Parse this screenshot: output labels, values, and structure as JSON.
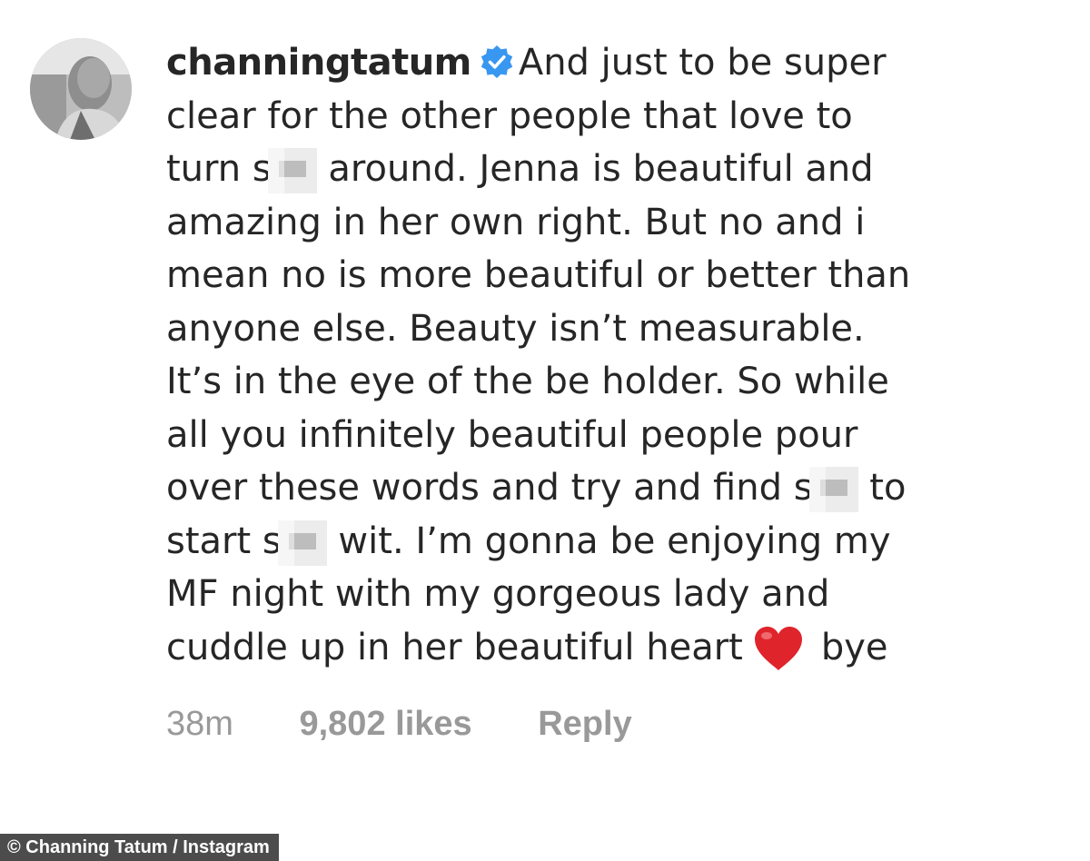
{
  "comment": {
    "username": "channingtatum",
    "verified": true,
    "icons": {
      "avatar": "profile-photo",
      "verified": "verified-badge-icon",
      "heart": "red-heart-emoji",
      "censor": "pixelated-censor-block"
    },
    "colors": {
      "verified_badge": "#3897f0",
      "heart": "#e0242c",
      "meta_text": "#999999"
    },
    "lines": [
      {
        "text": "And just to be super"
      },
      {
        "text": "clear for the other people that love to"
      },
      {
        "before": "turn s",
        "after": " around. Jenna is beautiful and"
      },
      {
        "text": "amazing in her own right. But no and i"
      },
      {
        "text": "mean no is more beautiful or better than"
      },
      {
        "text": "anyone else. Beauty isn’t measurable."
      },
      {
        "text": "It’s in the eye of the be holder. So while"
      },
      {
        "text": "all you infinitely beautiful people pour"
      },
      {
        "before": "over these words and try and find s",
        "after": " to"
      },
      {
        "before": "start s",
        "after": " wit. I’m gonna be enjoying my"
      },
      {
        "text": "MF night with my gorgeous lady and"
      },
      {
        "before": "cuddle up in her beautiful heart",
        "after": "bye"
      }
    ],
    "meta": {
      "timestamp": "38m",
      "likes": "9,802 likes",
      "reply": "Reply"
    }
  },
  "credit": "© Channing Tatum / Instagram"
}
